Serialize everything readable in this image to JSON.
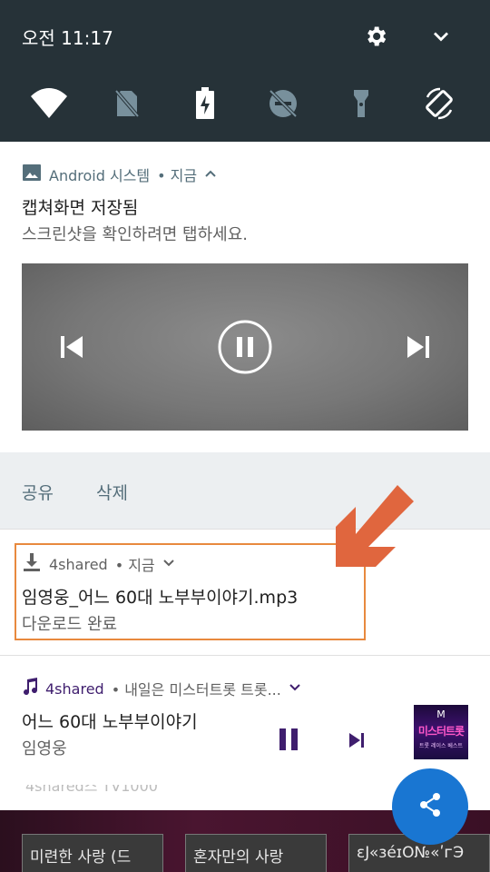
{
  "status": {
    "time": "오전 11:17"
  },
  "quick_settings": {
    "tiles": [
      "wifi-icon",
      "no-sim-icon",
      "battery-charging-icon",
      "do-not-disturb-off-icon",
      "flashlight-off-icon",
      "auto-rotate-icon"
    ],
    "top_icons": [
      "settings-icon",
      "expand-chevron-icon"
    ]
  },
  "notifications": {
    "screenshot": {
      "app": "Android 시스템",
      "time": "• 지금",
      "title": "캡쳐화면 저장됨",
      "text": "스크린샷을 확인하려면 탭하세요.",
      "actions": [
        "공유",
        "삭제"
      ]
    },
    "download": {
      "app": "4shared",
      "time": "• 지금",
      "title": "임영웅_어느 60대 노부부이야기.mp3",
      "text": "다운로드 완료"
    },
    "media": {
      "app": "4shared",
      "subtext": "• 내일은 미스터트롯 트롯...",
      "title": "어느 60대 노부부이야기",
      "artist": "임영웅",
      "album_art": {
        "top": "M",
        "title": "미스터트롯",
        "sub": "트롯 레이스 베스트"
      }
    }
  },
  "background_app": {
    "partial_text": "4shared스 TV1000",
    "cards": [
      "미련한 사랑 (드",
      "혼자만의 사랑",
      "ɛJ«ɜéɪO№«ʹᴦЭ"
    ]
  },
  "colors": {
    "header_bg": "#263238",
    "accent_orange": "#E0663E",
    "media_accent": "#3F1E6E",
    "fab": "#1976D2"
  }
}
